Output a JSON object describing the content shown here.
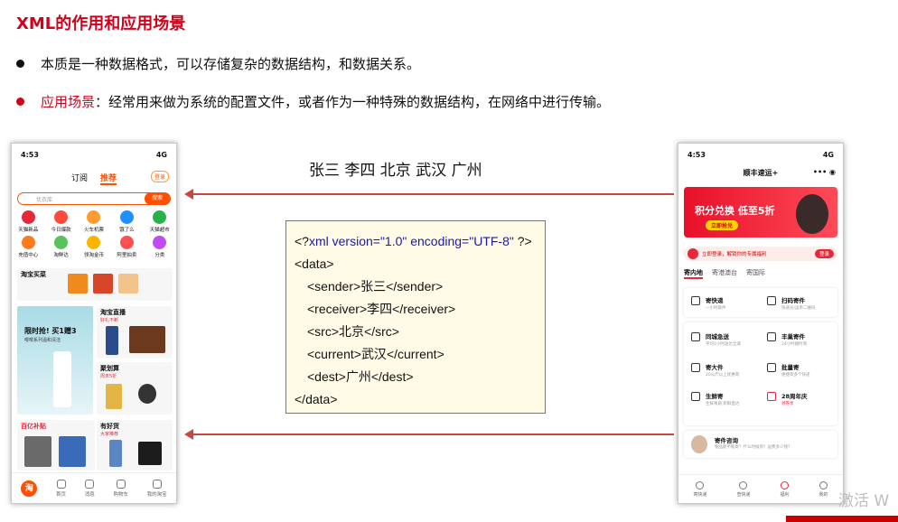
{
  "slide": {
    "title": "XML的作用和应用场景",
    "bullet1": "本质是一种数据格式，可以存储复杂的数据结构，和数据关系。",
    "bullet2_highlight": "应用场景",
    "bullet2_text": "：经常用来做为系统的配置文件，或者作为一种特殊的数据结构，在网络中进行传输。"
  },
  "names_label": "张三 李四 北京 武汉 广州",
  "xml": {
    "decl_open": "<?",
    "decl_body": "xml version=\"1.0\" encoding=\"UTF-8\" ",
    "decl_close": "?>",
    "root_open": "<data>",
    "sender_open": "<sender>",
    "sender_val": "张三",
    "sender_close": "</sender>",
    "receiver_open": "<receiver>",
    "receiver_val": "李四",
    "receiver_close": "</receiver>",
    "src_open": "<src>",
    "src_val": "北京",
    "src_close": "</src>",
    "current_open": "<current>",
    "current_val": "武汉",
    "current_close": "</current>",
    "dest_open": "<dest>",
    "dest_val": "广州",
    "dest_close": "</dest>",
    "root_close": "</data>"
  },
  "phone_left": {
    "time": "4:53",
    "signal": "4G",
    "tabs": [
      "订阅",
      "推荐"
    ],
    "login": "登录",
    "search_placeholder": "优衣库",
    "search_button": "搜索",
    "grid": [
      {
        "label": "天猫新品",
        "color": "#e5283a"
      },
      {
        "label": "今日爆款",
        "color": "#ff4a3a"
      },
      {
        "label": "火车机票",
        "color": "#ff9a2e"
      },
      {
        "label": "饿了么",
        "color": "#1e90ff"
      },
      {
        "label": "天猫超市",
        "color": "#27b34a"
      },
      {
        "label": "充值中心",
        "color": "#ff7a1a"
      },
      {
        "label": "淘鲜达",
        "color": "#5ac25a"
      },
      {
        "label": "领淘金币",
        "color": "#ffb400"
      },
      {
        "label": "阿里拍卖",
        "color": "#ff4f4f"
      },
      {
        "label": "分类",
        "color": "#c14cf0"
      }
    ],
    "card1_title": "淘宝买菜",
    "card2_title": "淘宝直播",
    "card2_sub": "好礼不断",
    "card3_title": "聚划算",
    "card3_sub": "周末5折",
    "card4_title": "百亿补贴",
    "card5_title": "有好货",
    "card5_sub": "大家推荐",
    "promo_big": "限时抢! 买1赠3",
    "promo_small": "嘤嘤系列温和清洁",
    "nav": [
      "首页",
      "消息",
      "购物车",
      "我的淘宝"
    ],
    "home_glyph": "淘"
  },
  "phone_right": {
    "time": "4:53",
    "signal": "4G",
    "header": "顺丰速运+",
    "more": "•••  ◉",
    "banner_text": "积分兑换 低至5折",
    "banner_btn": "立即抢兑",
    "login_text": "立即登录，解锁你的专属福利",
    "login_btn": "登录",
    "tabs": [
      "寄内地",
      "寄港澳台",
      "寄国际"
    ],
    "items": [
      {
        "title": "寄快递",
        "sub": "一小时取件"
      },
      {
        "title": "扫码寄件",
        "sub": "快递员/运单二维码"
      },
      {
        "title": "同城急送",
        "sub": "平均1小时送达全城"
      },
      {
        "title": "丰巢寄件",
        "sub": "24小时随时寄"
      },
      {
        "title": "寄大件",
        "sub": "20公斤以上优惠寄"
      },
      {
        "title": "批量寄",
        "sub": "便捷寄多个快递"
      },
      {
        "title": "生鲜寄",
        "sub": "生鲜果蔬 新鲜直达"
      },
      {
        "title": "28周年庆",
        "sub": "领券享"
      }
    ],
    "consult_title": "寄件咨询",
    "consult_sub": "物品能不能寄？什么时候到？运费多少钱？",
    "nav": [
      "寄快递",
      "查快递",
      "福利",
      "我的"
    ]
  },
  "watermark": "激活 W"
}
